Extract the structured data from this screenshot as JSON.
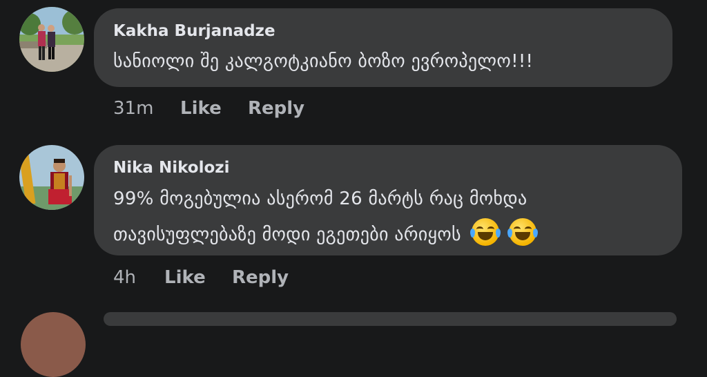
{
  "comments": [
    {
      "author": "Kakha Burjanadze",
      "lines": [
        "სანიოლი შე კალგოტკიანო ბოზო ევროპელო!!!"
      ],
      "time": "31m",
      "like_label": "Like",
      "reply_label": "Reply",
      "avatar_icon": "avatar-photo-couple"
    },
    {
      "author": "Nika Nikolozi",
      "lines": [
        "99% მოგებულია  ასერომ 26 მარტს  რაც მოხდა",
        "თავისუფლებაზე მოდი ეგეთები არიყოს"
      ],
      "emoji": [
        "face-with-tears-of-joy",
        "face-with-tears-of-joy"
      ],
      "time": "4h",
      "like_label": "Like",
      "reply_label": "Reply",
      "avatar_icon": "avatar-photo-man-traditional-costume"
    }
  ],
  "colors": {
    "background": "#18191a",
    "bubble": "#3a3b3c",
    "text": "#e4e6eb",
    "secondary": "#b0b3b8"
  }
}
